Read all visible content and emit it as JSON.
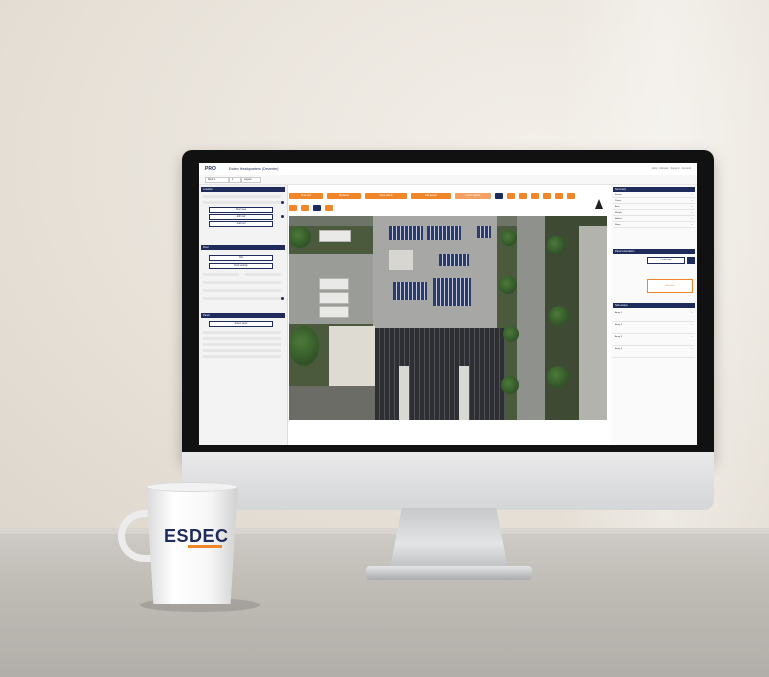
{
  "brand": {
    "navy": "#1f2b5b",
    "orange": "#f0852a"
  },
  "app": {
    "logo": "PRO",
    "project_title": "Esdec Headquarters (Deventer)",
    "top_right_links": "Help · Manual · Support · Account",
    "subbar_selects": [
      "Roof 1",
      "1",
      "Layout"
    ]
  },
  "left_panel": {
    "section_1_title": "Location",
    "section_1_buttons": [
      "Roof area",
      "Edit roof",
      "Add roof"
    ],
    "section_2_title": "Roof",
    "section_2_buttons": [
      "Flat",
      "Roof settings"
    ],
    "section_3_title": "Panel",
    "section_3_buttons": [
      "Select panel"
    ]
  },
  "toolbar": {
    "buttons": [
      "Draw roof",
      "Obstacles",
      "Place panels",
      "Edit panels",
      "Layout options"
    ],
    "icon_buttons": [
      "undo-icon",
      "redo-icon",
      "zoom-in-icon",
      "zoom-out-icon",
      "layers-icon"
    ]
  },
  "right_panel": {
    "section_1_title": "Summary",
    "summary_rows": [
      {
        "k": "Panels",
        "v": "—"
      },
      {
        "k": "Power",
        "v": "—"
      },
      {
        "k": "Area",
        "v": "—"
      },
      {
        "k": "Weight",
        "v": "—"
      },
      {
        "k": "Ballast",
        "v": "—"
      },
      {
        "k": "Rows",
        "v": "—"
      }
    ],
    "section_2_title": "Panel orientation",
    "section_2_button": "Landscape",
    "section_2_box": "Generate",
    "section_3_title": "Sub-arrays",
    "section_3_rows": [
      {
        "k": "Array 1",
        "v": "—"
      },
      {
        "k": "Array 2",
        "v": "—"
      },
      {
        "k": "Array 3",
        "v": "—"
      },
      {
        "k": "Array 4",
        "v": "—"
      }
    ]
  },
  "mug": {
    "logo_text": "ESDEC"
  }
}
